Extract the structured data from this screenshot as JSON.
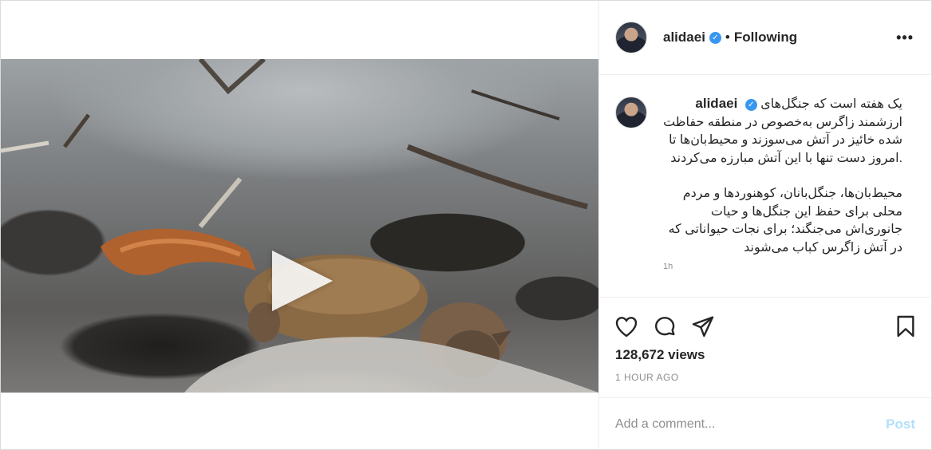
{
  "post": {
    "username": "alidaei",
    "verified_mark": "✓",
    "dot": "•",
    "follow_status": "Following",
    "more_menu": "•••",
    "caption": {
      "username": "alidaei",
      "paragraph_1": "یک هفته است که جنگل‌های ارزشمند زاگرس به‌خصوص در منطقه حفاظت شده خائیز در آتش می‌سوزند و محیط‌بان‌ها تا امروز دست تنها با این آتش مبارزه می‌کردند.",
      "paragraph_2": "محیط‌بان‌ها، جنگل‌بانان، کوهنوردها و مردم محلی برای حفظ این جنگل‌ها و حیات جانوری‌اش می‌جنگند؛ برای نجات حیواناتی که در آتش زاگرس کباب می‌شوند",
      "time": "1h"
    },
    "views": "128,672 views",
    "timestamp": "1 HOUR AGO",
    "comment": {
      "placeholder": "Add a comment...",
      "post_label": "Post"
    },
    "icons": {
      "like": "heart-icon",
      "comment": "comment-icon",
      "share": "share-icon",
      "save": "bookmark-icon",
      "play": "play-icon",
      "verified": "verified-badge-icon"
    },
    "colors": {
      "verified": "#3897f0",
      "post_disabled": "#b2dffc",
      "muted": "#8e8e8e",
      "text": "#262626"
    }
  }
}
